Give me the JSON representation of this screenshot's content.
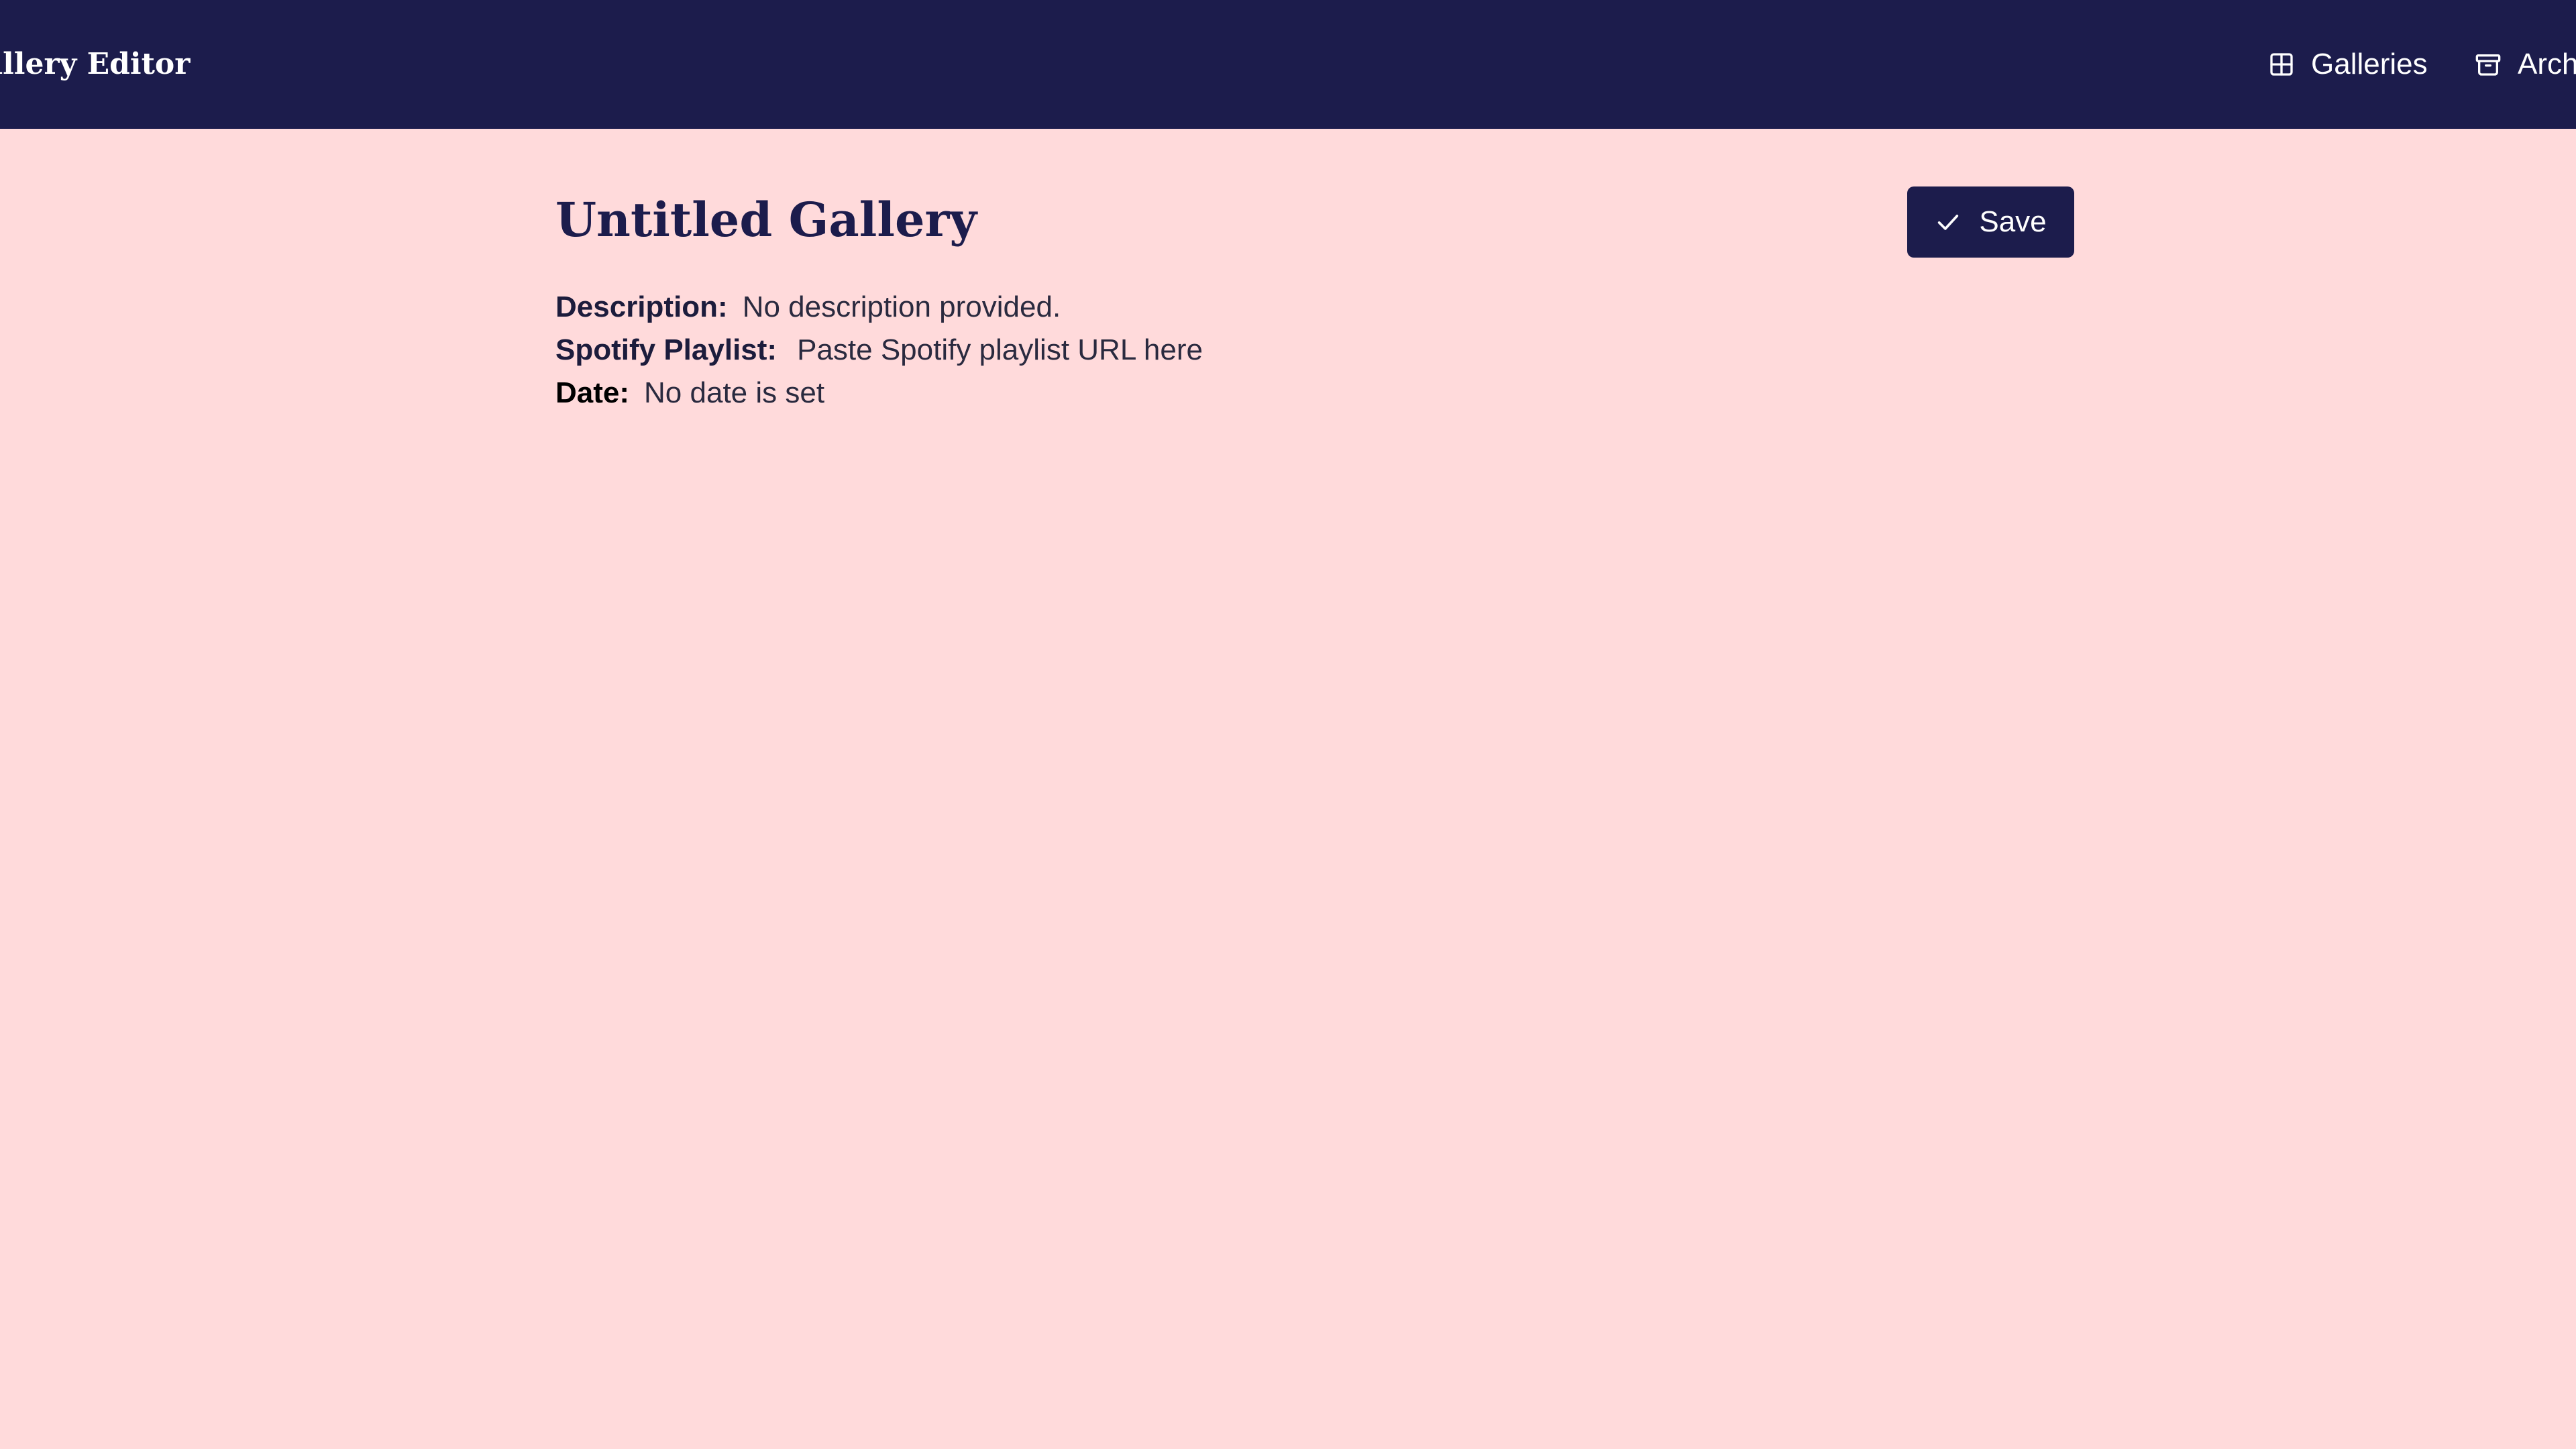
{
  "header": {
    "brand": "Gallery Editor",
    "nav": [
      {
        "label": "Galleries",
        "icon": "grid-icon"
      },
      {
        "label": "Archive",
        "icon": "archive-icon"
      }
    ]
  },
  "gallery": {
    "title": "Untitled Gallery",
    "save_label": "Save",
    "fields": {
      "description": {
        "label": "Description:",
        "value": "No description provided."
      },
      "spotify": {
        "label": "Spotify Playlist:",
        "placeholder": "Paste Spotify playlist URL here"
      },
      "date": {
        "label": "Date:",
        "value": "No date is set"
      }
    }
  },
  "colors": {
    "header_bg": "#1c1c4c",
    "page_bg": "#ffdadb",
    "accent": "#1c1c4c"
  }
}
